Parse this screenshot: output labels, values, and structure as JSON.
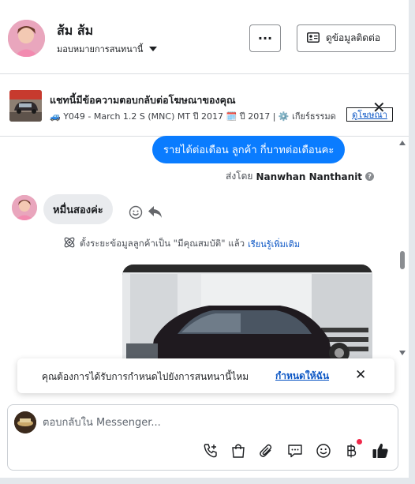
{
  "header": {
    "contact_name": "ส้ม ส้ม",
    "assign_label": "มอบหมายการสนทนานี้",
    "more_label": "···",
    "contact_info_label": "ดูข้อมูลติดต่อ"
  },
  "ad": {
    "title": "แชทนี้มีข้อความตอบกลับต่อโฆษณาของคุณ",
    "details": "Y049 - March 1.2 S (MNC) MT ปี 2017 🗓️ ปี 2017 | ⚙️ เกียร์ธรรมด",
    "view_ad_label": "ดูโฆษณา",
    "close_label": "✕"
  },
  "messages": {
    "outgoing_text": "รายได้ต่อเดือน ลูกค้า  กี่บาทต่อเดือนคะ",
    "sent_by_prefix": "ส่งโดย",
    "sent_by_name": "Nanwhan Nanthanit",
    "incoming_text": "หมื่นสองค่ะ",
    "system_note": "ตั้งระยะข้อมูลลูกค้าเป็น \"มีคุณสมบัติ\" แล้ว",
    "learn_more": "เรียนรู้เพิ่มเติม"
  },
  "toast": {
    "text": "คุณต้องการได้รับการกำหนดไปยังการสนทนานี้ไหม",
    "action_label": "กำหนดให้ฉัน",
    "close_label": "✕"
  },
  "composer": {
    "placeholder": "ตอบกลับใน Messenger..."
  },
  "colors": {
    "accent": "#0a7cff",
    "link": "#0a55c4",
    "notification_dot": "#f0284a"
  },
  "icons": [
    "contact-card-icon",
    "caret-down-icon",
    "info-icon",
    "smiley-icon",
    "reply-icon",
    "ai-sparkle-icon",
    "phone-plus-icon",
    "shopping-bag-icon",
    "paperclip-icon",
    "chat-bubble-icon",
    "emoji-icon",
    "baht-icon",
    "thumbs-up-icon"
  ]
}
